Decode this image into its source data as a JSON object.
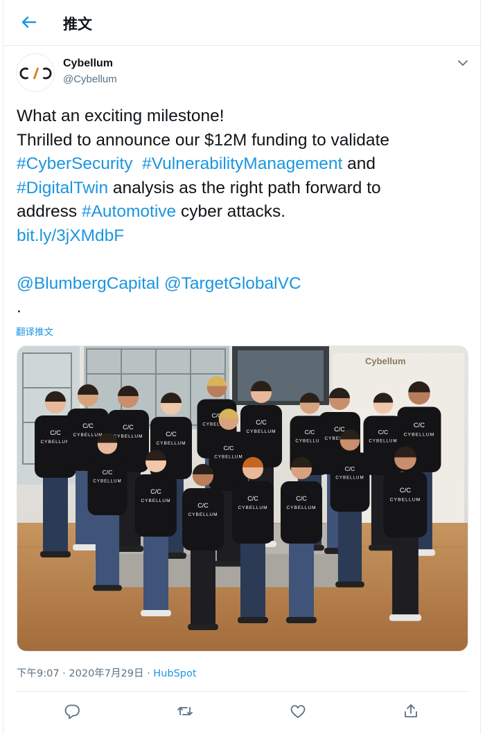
{
  "header": {
    "title": "推文"
  },
  "author": {
    "name": "Cybellum",
    "handle": "@Cybellum",
    "logo_text": "C/C"
  },
  "tweet": {
    "lines": [
      [
        {
          "t": "What an exciting milestone!",
          "link": false
        }
      ],
      [
        {
          "t": "Thrilled to announce our $12M funding to validate",
          "link": false
        }
      ],
      [
        {
          "t": "#CyberSecurity",
          "link": true
        },
        {
          "t": "  ",
          "link": false
        },
        {
          "t": "#VulnerabilityManagement",
          "link": true
        },
        {
          "t": " and",
          "link": false
        }
      ],
      [
        {
          "t": "#DigitalTwin",
          "link": true
        },
        {
          "t": " analysis as the right path forward to",
          "link": false
        }
      ],
      [
        {
          "t": "address ",
          "link": false
        },
        {
          "t": "#Automotive",
          "link": true
        },
        {
          "t": " cyber attacks.",
          "link": false
        }
      ],
      [
        {
          "t": "bit.ly/3jXMdbF",
          "link": true
        }
      ],
      [
        {
          "t": "",
          "link": false
        }
      ],
      [
        {
          "t": "@BlumbergCapital",
          "link": true
        },
        {
          "t": " ",
          "link": false
        },
        {
          "t": "@TargetGlobalVC",
          "link": true
        }
      ],
      [
        {
          "t": ".",
          "link": false
        }
      ]
    ]
  },
  "translate_label": "翻译推文",
  "photo": {
    "wall_sign": "Cybellum",
    "shirt_text": "CYBELLUM",
    "shirt_logo": "C/C"
  },
  "meta": {
    "timestamp": "下午9:07 · 2020年7月29日 · ",
    "source": "HubSpot"
  },
  "colors": {
    "link": "#1b95e0",
    "secondary": "#5b7083",
    "border": "#e6ecf0"
  },
  "actions": [
    {
      "name": "reply-icon"
    },
    {
      "name": "retweet-icon"
    },
    {
      "name": "like-icon"
    },
    {
      "name": "share-icon"
    }
  ]
}
